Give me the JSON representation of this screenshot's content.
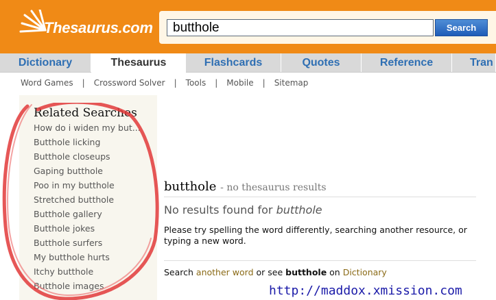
{
  "brand": {
    "logo_text": "Thesaurus.com"
  },
  "search": {
    "value": "butthole",
    "button_label": "Search"
  },
  "tabs": [
    {
      "label": "Dictionary",
      "active": false
    },
    {
      "label": "Thesaurus",
      "active": true
    },
    {
      "label": "Flashcards",
      "active": false
    },
    {
      "label": "Quotes",
      "active": false
    },
    {
      "label": "Reference",
      "active": false
    },
    {
      "label": "Tran",
      "active": false
    }
  ],
  "subnav": {
    "items": [
      "Word Games",
      "Crossword Solver",
      "Tools",
      "Mobile",
      "Sitemap"
    ],
    "separator": "|"
  },
  "sidebar": {
    "title": "Related Searches",
    "items": [
      "How do i widen my but...",
      "Butthole licking",
      "Butthole closeups",
      "Gaping butthole",
      "Poo in my butthole",
      "Stretched butthole",
      "Butthole gallery",
      "Butthole jokes",
      "Butthole surfers",
      "My butthole hurts",
      "Itchy butthole",
      "Butthole images"
    ]
  },
  "result": {
    "headword": "butthole",
    "headword_note": "- no thesaurus results",
    "no_results_prefix": "No results found for ",
    "no_results_term": "butthole",
    "suggestion": "Please try spelling the word differently, searching another resource, or typing a new word.",
    "see_prefix": "Search ",
    "see_link1": "another word",
    "see_middle": " or see ",
    "see_term": "butthole",
    "see_on": " on ",
    "see_link2": "Dictionary"
  },
  "watermark": "http://maddox.xmission.com",
  "colors": {
    "header": "#f08a16",
    "tab_link": "#2f6fb3",
    "circle": "#e23a3a",
    "watermark": "#1a1aa8"
  }
}
